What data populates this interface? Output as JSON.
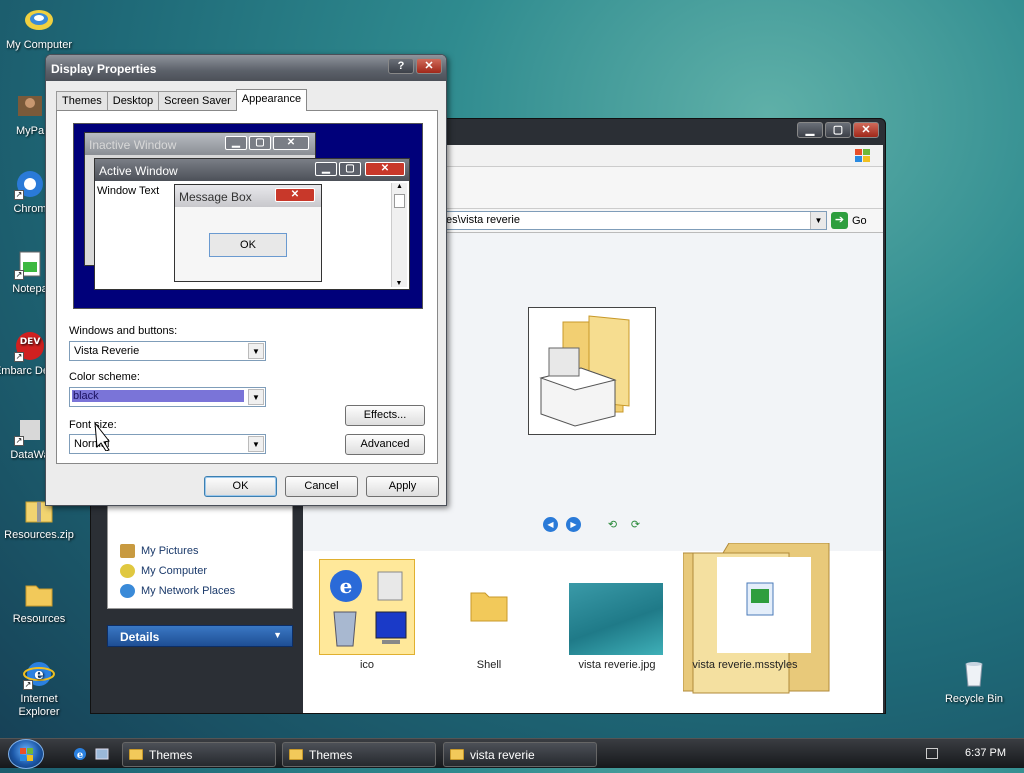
{
  "desktop": {
    "icons": [
      {
        "label": "My Computer"
      },
      {
        "label": "MyPa"
      },
      {
        "label": "Chrom"
      },
      {
        "label": "Notepa"
      },
      {
        "label": "Embarc Dev-C"
      },
      {
        "label": "DataWa"
      },
      {
        "label": "Resources.zip"
      },
      {
        "label": "Resources"
      },
      {
        "label": "Internet Explorer"
      },
      {
        "label": "Recycle Bin"
      }
    ]
  },
  "explorer": {
    "address": "es\\vista reverie",
    "go_label": "Go",
    "tasks": [
      "My Pictures",
      "My Computer",
      "My Network Places"
    ],
    "details_label": "Details",
    "files": [
      {
        "label": "ico"
      },
      {
        "label": "Shell"
      },
      {
        "label": "vista reverie.jpg"
      },
      {
        "label": "vista reverie.msstyles"
      }
    ]
  },
  "dialog": {
    "title": "Display Properties",
    "tabs": [
      "Themes",
      "Desktop",
      "Screen Saver",
      "Appearance"
    ],
    "active_tab": "Appearance",
    "preview": {
      "inactive_title": "Inactive Window",
      "active_title": "Active Window",
      "window_text": "Window Text",
      "msgbox_title": "Message Box",
      "msgbox_ok": "OK"
    },
    "windows_buttons_label": "Windows and buttons:",
    "windows_buttons_value": "Vista Reverie",
    "color_scheme_label": "Color scheme:",
    "color_scheme_value": "black",
    "font_size_label": "Font size:",
    "font_size_value": "Normal",
    "effects_label": "Effects...",
    "advanced_label": "Advanced",
    "ok_label": "OK",
    "cancel_label": "Cancel",
    "apply_label": "Apply"
  },
  "taskbar": {
    "buttons": [
      "Themes",
      "Themes",
      "vista reverie"
    ],
    "clock": "6:37 PM"
  },
  "colors": {
    "preview_bg": "#00007a",
    "selection": "#7a74d8",
    "accent": "#1e4e94"
  }
}
